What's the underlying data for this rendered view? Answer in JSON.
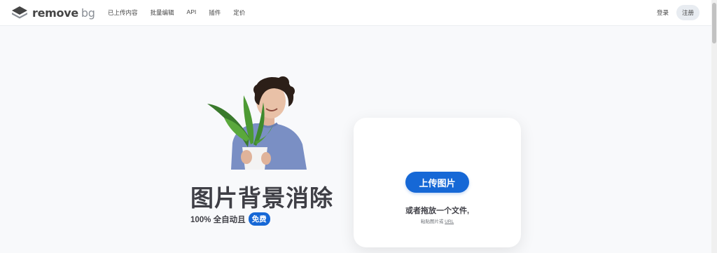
{
  "header": {
    "logo_text": "remove",
    "logo_suffix": "bg",
    "nav": [
      "已上传内容",
      "批量编辑",
      "API",
      "插件",
      "定价"
    ],
    "login": "登录",
    "signup": "注册"
  },
  "hero": {
    "headline": "图片背景消除",
    "subline": "100% 全自动且",
    "badge": "免费"
  },
  "upload": {
    "button": "上传图片",
    "drop_text": "或者拖放一个文件,",
    "paste_prefix": "粘贴图片或",
    "paste_url": "URL"
  },
  "colors": {
    "accent": "#1668d6",
    "text": "#3f3f46",
    "background": "#f8f9fb"
  }
}
